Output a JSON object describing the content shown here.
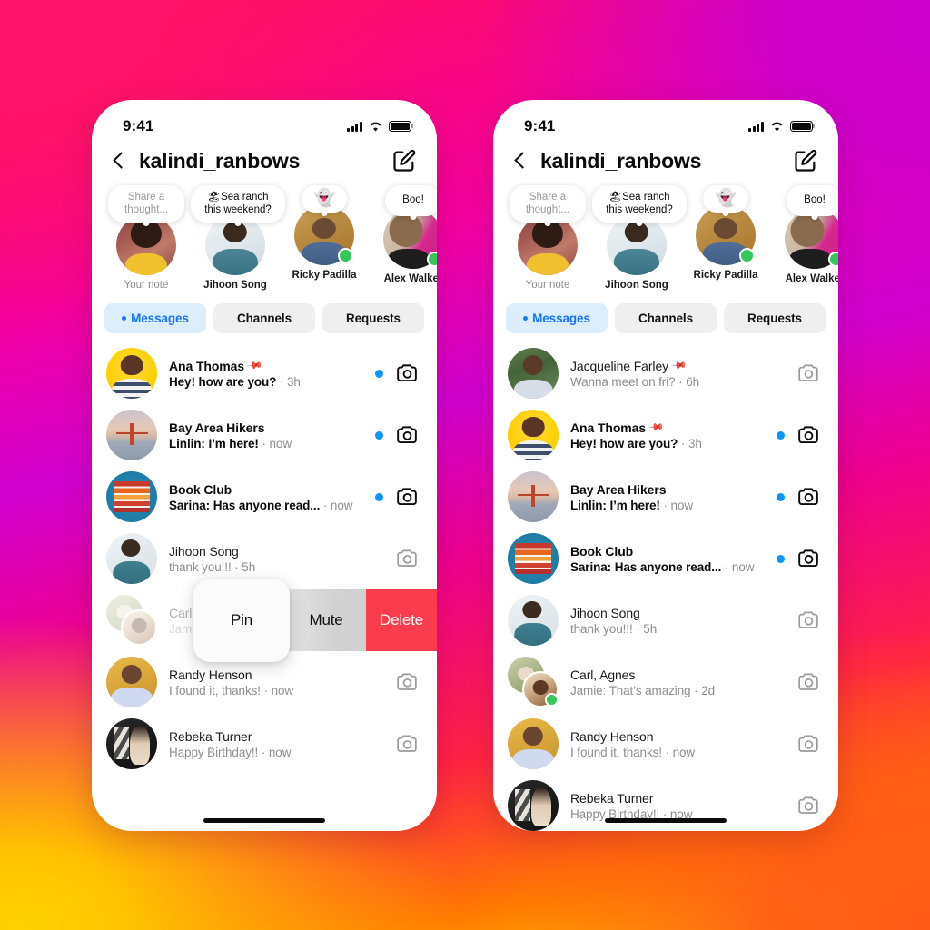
{
  "background": {
    "gradient_colors": [
      "#ff0f5f",
      "#cc00cc",
      "#ff2244",
      "#ff7a00",
      "#ffd000"
    ]
  },
  "colors": {
    "accent_blue": "#0a95f7",
    "tab_active_bg": "#dcedfb",
    "tab_active_text": "#1877f2",
    "delete_red": "#fa3c4c",
    "mute_gray": "#d2d2d2",
    "online_green": "#34c759",
    "muted_text": "#8e8e8e"
  },
  "status_bar": {
    "time": "9:41",
    "signal_icon": "cellular-bars-icon",
    "wifi_icon": "wifi-icon",
    "battery_icon": "battery-icon"
  },
  "header": {
    "back_icon": "back-chevron-icon",
    "title": "kalindi_ranbows",
    "compose_icon": "compose-icon"
  },
  "notes": [
    {
      "bubble": "Share a thought...",
      "name": "Your note",
      "online": false,
      "style": "placeholder",
      "art": "n-you"
    },
    {
      "bubble": "🏖Sea ranch this weekend?",
      "name": "Jihoon Song",
      "online": false,
      "style": "wide",
      "art": "n-jihoon"
    },
    {
      "bubble": "👻",
      "name": "Ricky Padilla",
      "online": true,
      "style": "emoji",
      "art": "n-ricky"
    },
    {
      "bubble": "Boo!",
      "name": "Alex Walker",
      "online": true,
      "style": "short",
      "art": "n-alex"
    }
  ],
  "tabs": [
    {
      "label": "Messages",
      "active": true,
      "dot": true
    },
    {
      "label": "Channels",
      "active": false,
      "dot": false
    },
    {
      "label": "Requests",
      "active": false,
      "dot": false
    }
  ],
  "swipe_actions": {
    "pin_label": "Pin",
    "mute_label": "Mute",
    "delete_label": "Delete"
  },
  "left_phone": {
    "threads": [
      {
        "name": "Ana Thomas",
        "pinned": true,
        "preview": "Hey! how are you?",
        "time": "3h",
        "unread": true,
        "online": false,
        "art": "a-ana"
      },
      {
        "name": "Bay Area Hikers",
        "pinned": false,
        "preview": "Linlin: I’m here!",
        "time": "now",
        "unread": true,
        "online": false,
        "art": "a-bridge"
      },
      {
        "name": "Book Club",
        "pinned": false,
        "preview": "Sarina: Has anyone read...",
        "time": "now",
        "unread": true,
        "online": false,
        "art": "a-books"
      },
      {
        "name": "Jihoon Song",
        "pinned": false,
        "preview": "thank you!!!",
        "time": "5h",
        "unread": false,
        "online": false,
        "art": "a-jihoon"
      },
      {
        "name": "Carl, Agnes",
        "pinned": false,
        "preview": "Jamie: That’s amazing",
        "time": "2d",
        "unread": false,
        "online": true,
        "art": "a-carl",
        "swiped": true
      },
      {
        "name": "Randy Henson",
        "pinned": false,
        "preview": "I found it, thanks!",
        "time": "now",
        "unread": false,
        "online": false,
        "art": "a-randy"
      },
      {
        "name": "Rebeka Turner",
        "pinned": false,
        "preview": "Happy Birthday!!",
        "time": "now",
        "unread": false,
        "online": false,
        "art": "a-rebeka"
      }
    ]
  },
  "right_phone": {
    "threads": [
      {
        "name": "Jacqueline Farley",
        "pinned": true,
        "preview": "Wanna meet on fri?",
        "time": "6h",
        "unread": false,
        "online": false,
        "art": "a-jacq"
      },
      {
        "name": "Ana Thomas",
        "pinned": true,
        "preview": "Hey! how are you?",
        "time": "3h",
        "unread": true,
        "online": false,
        "art": "a-ana"
      },
      {
        "name": "Bay Area Hikers",
        "pinned": false,
        "preview": "Linlin: I’m here!",
        "time": "now",
        "unread": true,
        "online": false,
        "art": "a-bridge"
      },
      {
        "name": "Book Club",
        "pinned": false,
        "preview": "Sarina: Has anyone read...",
        "time": "now",
        "unread": true,
        "online": false,
        "art": "a-books"
      },
      {
        "name": "Jihoon Song",
        "pinned": false,
        "preview": "thank you!!!",
        "time": "5h",
        "unread": false,
        "online": false,
        "art": "a-jihoon"
      },
      {
        "name": "Carl, Agnes",
        "pinned": false,
        "preview": "Jamie: That’s amazing",
        "time": "2d",
        "unread": false,
        "online": true,
        "art": "a-carl"
      },
      {
        "name": "Randy Henson",
        "pinned": false,
        "preview": "I found it, thanks!",
        "time": "now",
        "unread": false,
        "online": false,
        "art": "a-randy"
      },
      {
        "name": "Rebeka Turner",
        "pinned": false,
        "preview": "Happy Birthday!!",
        "time": "now",
        "unread": false,
        "online": false,
        "art": "a-rebeka"
      }
    ]
  }
}
